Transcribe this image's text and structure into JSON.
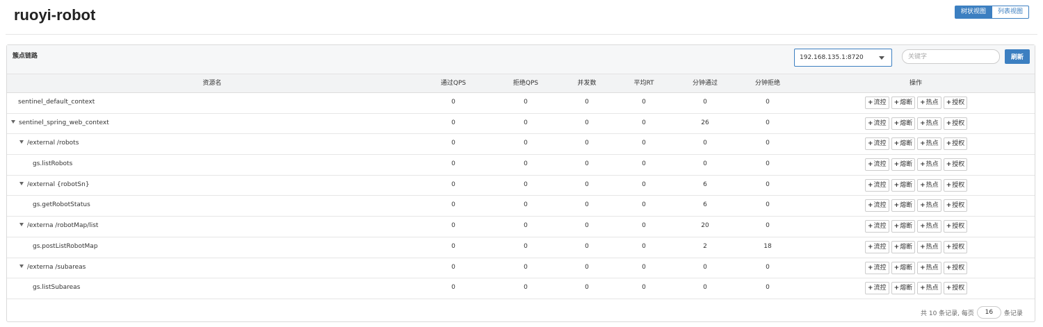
{
  "header": {
    "title": "ruoyi-robot",
    "tree_view_label": "树状视图",
    "list_view_label": "列表视图"
  },
  "panel": {
    "title": "簇点链路",
    "machine_selected": "192.168.135.1:8720",
    "keyword_placeholder": "关键字",
    "refresh_label": "刷新"
  },
  "table": {
    "columns": [
      "资源名",
      "通过QPS",
      "拒绝QPS",
      "并发数",
      "平均RT",
      "分钟通过",
      "分钟拒绝",
      "操作"
    ],
    "action_labels": [
      "流控",
      "熔断",
      "热点",
      "授权"
    ],
    "rows": [
      {
        "name": "sentinel_default_context",
        "level": 0,
        "expandable": false,
        "pass_qps": "0",
        "block_qps": "0",
        "concurrency": "0",
        "avg_rt": "0",
        "min_pass": "0",
        "min_block": "0"
      },
      {
        "name": "sentinel_spring_web_context",
        "level": 0,
        "expandable": true,
        "pass_qps": "0",
        "block_qps": "0",
        "concurrency": "0",
        "avg_rt": "0",
        "min_pass": "26",
        "min_block": "0"
      },
      {
        "name": "/external        /robots",
        "level": 1,
        "expandable": true,
        "pass_qps": "0",
        "block_qps": "0",
        "concurrency": "0",
        "avg_rt": "0",
        "min_pass": "0",
        "min_block": "0"
      },
      {
        "name": "gs.listRobots",
        "level": 2,
        "expandable": false,
        "pass_qps": "0",
        "block_qps": "0",
        "concurrency": "0",
        "avg_rt": "0",
        "min_pass": "0",
        "min_block": "0"
      },
      {
        "name": "/external              {robotSn}",
        "level": 1,
        "expandable": true,
        "pass_qps": "0",
        "block_qps": "0",
        "concurrency": "0",
        "avg_rt": "0",
        "min_pass": "6",
        "min_block": "0"
      },
      {
        "name": "gs.getRobotStatus",
        "level": 2,
        "expandable": false,
        "pass_qps": "0",
        "block_qps": "0",
        "concurrency": "0",
        "avg_rt": "0",
        "min_pass": "6",
        "min_block": "0"
      },
      {
        "name": "/externa            /robotMap/list",
        "level": 1,
        "expandable": true,
        "pass_qps": "0",
        "block_qps": "0",
        "concurrency": "0",
        "avg_rt": "0",
        "min_pass": "20",
        "min_block": "0"
      },
      {
        "name": "gs.postListRobotMap",
        "level": 2,
        "expandable": false,
        "pass_qps": "0",
        "block_qps": "0",
        "concurrency": "0",
        "avg_rt": "0",
        "min_pass": "2",
        "min_block": "18"
      },
      {
        "name": "/externa            /subareas",
        "level": 1,
        "expandable": true,
        "pass_qps": "0",
        "block_qps": "0",
        "concurrency": "0",
        "avg_rt": "0",
        "min_pass": "0",
        "min_block": "0"
      },
      {
        "name": "gs.listSubareas",
        "level": 2,
        "expandable": false,
        "pass_qps": "0",
        "block_qps": "0",
        "concurrency": "0",
        "avg_rt": "0",
        "min_pass": "0",
        "min_block": "0"
      }
    ]
  },
  "pagination": {
    "prefix": "共 10 条记录, 每页",
    "page_size": "16",
    "suffix": "条记录"
  },
  "colors": {
    "primary": "#3c7fc1",
    "header_bg": "#f6f7f8"
  },
  "icons": [
    "chevron-down-icon",
    "caret-down-icon",
    "plus-icon"
  ]
}
